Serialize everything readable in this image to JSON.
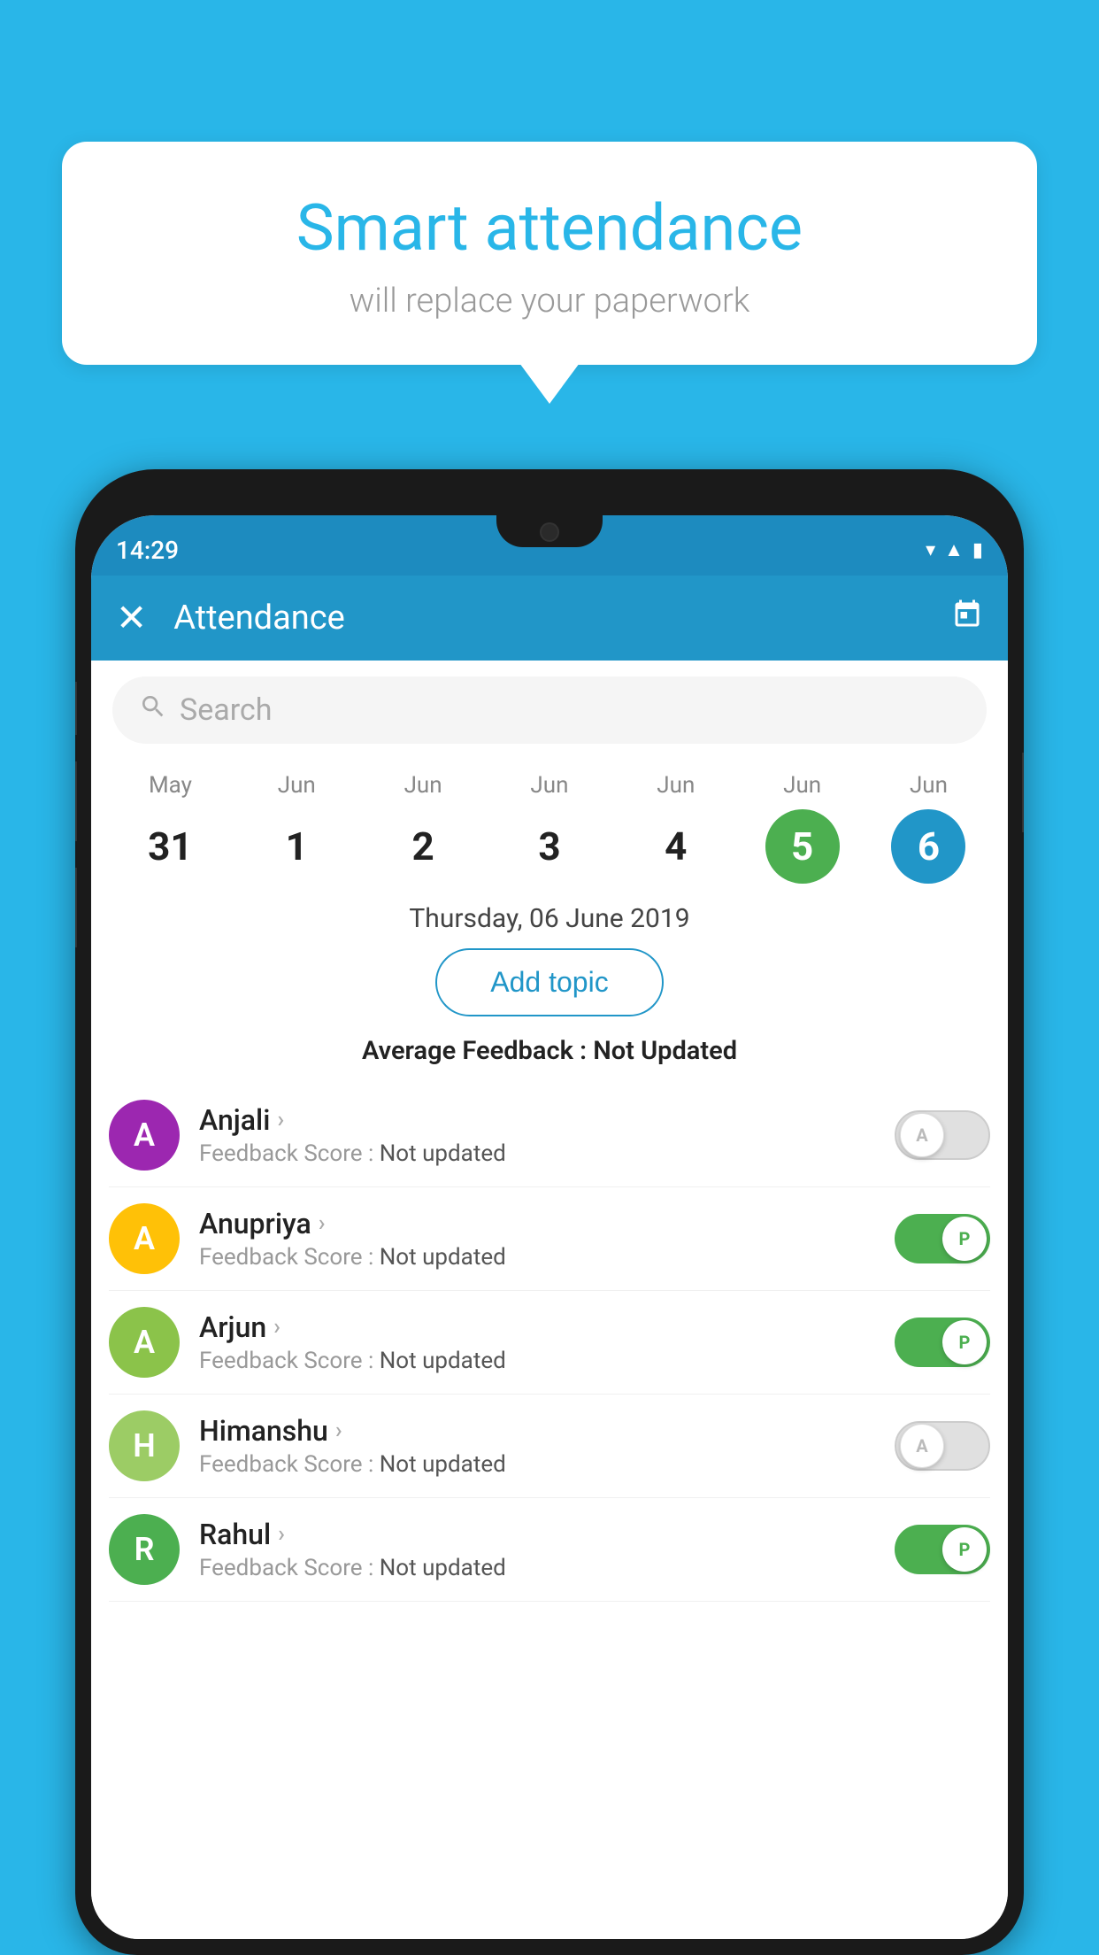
{
  "background_color": "#29b6e8",
  "bubble": {
    "title": "Smart attendance",
    "subtitle": "will replace your paperwork"
  },
  "status_bar": {
    "time": "14:29",
    "wifi_icon": "▼",
    "signal_icon": "▲",
    "battery_icon": "▮"
  },
  "app_bar": {
    "title": "Attendance",
    "close_label": "✕",
    "calendar_icon": "📅"
  },
  "search": {
    "placeholder": "Search"
  },
  "calendar": {
    "days": [
      {
        "month": "May",
        "date": "31",
        "state": "normal"
      },
      {
        "month": "Jun",
        "date": "1",
        "state": "normal"
      },
      {
        "month": "Jun",
        "date": "2",
        "state": "normal"
      },
      {
        "month": "Jun",
        "date": "3",
        "state": "normal"
      },
      {
        "month": "Jun",
        "date": "4",
        "state": "normal"
      },
      {
        "month": "Jun",
        "date": "5",
        "state": "today"
      },
      {
        "month": "Jun",
        "date": "6",
        "state": "selected"
      }
    ]
  },
  "selected_date": "Thursday, 06 June 2019",
  "add_topic_label": "Add topic",
  "avg_feedback_label": "Average Feedback :",
  "avg_feedback_value": "Not Updated",
  "students": [
    {
      "name": "Anjali",
      "avatar_letter": "A",
      "avatar_color": "#9c27b0",
      "feedback_label": "Feedback Score :",
      "feedback_value": "Not updated",
      "toggle_state": "off",
      "toggle_letter": "A"
    },
    {
      "name": "Anupriya",
      "avatar_letter": "A",
      "avatar_color": "#ffc107",
      "feedback_label": "Feedback Score :",
      "feedback_value": "Not updated",
      "toggle_state": "on",
      "toggle_letter": "P"
    },
    {
      "name": "Arjun",
      "avatar_letter": "A",
      "avatar_color": "#8bc34a",
      "feedback_label": "Feedback Score :",
      "feedback_value": "Not updated",
      "toggle_state": "on",
      "toggle_letter": "P"
    },
    {
      "name": "Himanshu",
      "avatar_letter": "H",
      "avatar_color": "#9ccc65",
      "feedback_label": "Feedback Score :",
      "feedback_value": "Not updated",
      "toggle_state": "off",
      "toggle_letter": "A"
    },
    {
      "name": "Rahul",
      "avatar_letter": "R",
      "avatar_color": "#4caf50",
      "feedback_label": "Feedback Score :",
      "feedback_value": "Not updated",
      "toggle_state": "on",
      "toggle_letter": "P"
    }
  ]
}
